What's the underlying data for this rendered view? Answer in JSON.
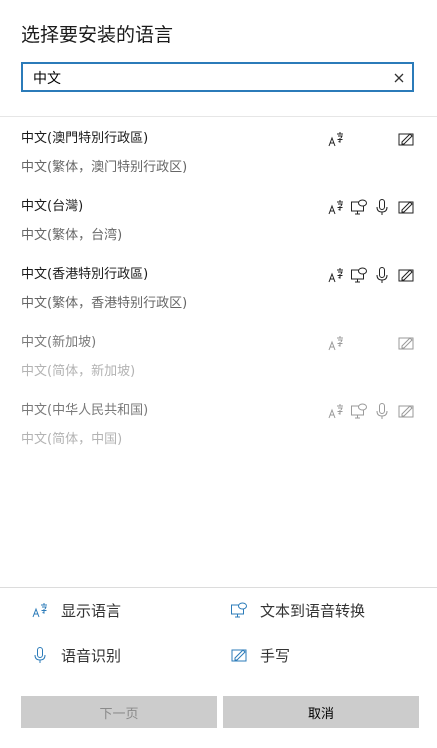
{
  "dialog": {
    "title": "选择要安装的语言"
  },
  "search": {
    "value": "中文"
  },
  "languages": [
    {
      "name": "中文(澳門特別行政區)",
      "sub": "中文(繁体，澳门特别行政区)",
      "disabled": false,
      "features": [
        "display-language",
        "handwriting"
      ]
    },
    {
      "name": "中文(台灣)",
      "sub": "中文(繁体，台湾)",
      "disabled": false,
      "features": [
        "display-language",
        "text-to-speech",
        "speech-recognition",
        "handwriting"
      ]
    },
    {
      "name": "中文(香港特別行政區)",
      "sub": "中文(繁体，香港特别行政区)",
      "disabled": false,
      "features": [
        "display-language",
        "text-to-speech",
        "speech-recognition",
        "handwriting"
      ]
    },
    {
      "name": "中文(新加坡)",
      "sub": "中文(简体，新加坡)",
      "disabled": true,
      "features": [
        "display-language",
        "handwriting"
      ]
    },
    {
      "name": "中文(中华人民共和国)",
      "sub": "中文(简体，中国)",
      "disabled": true,
      "features": [
        "display-language",
        "text-to-speech",
        "speech-recognition",
        "handwriting"
      ]
    }
  ],
  "legend": {
    "display_language": "显示语言",
    "text_to_speech": "文本到语音转换",
    "speech_recognition": "语音识别",
    "handwriting": "手写"
  },
  "buttons": {
    "next": "下一页",
    "cancel": "取消"
  },
  "colors": {
    "accent": "#2b7bb9",
    "button_bg": "#cccccc"
  }
}
